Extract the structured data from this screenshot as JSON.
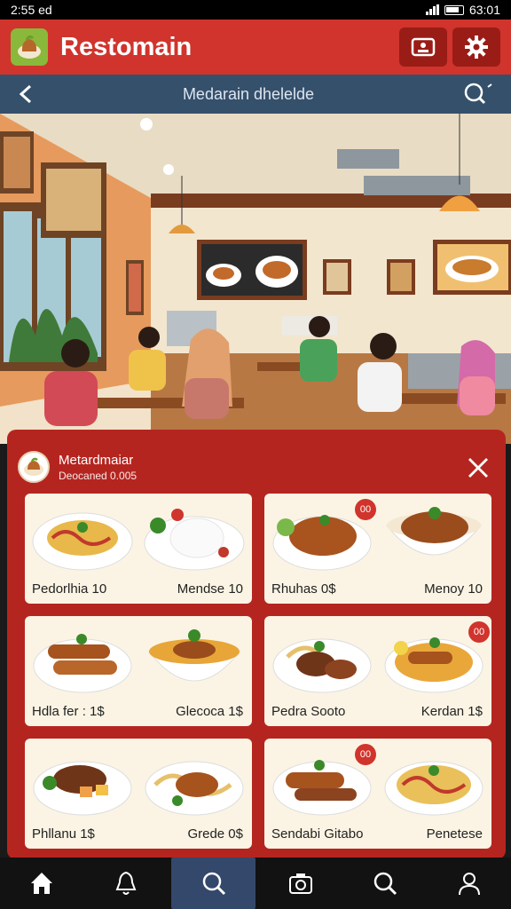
{
  "status_bar": {
    "time": "2:55 ed",
    "clock": "63:01"
  },
  "app_bar": {
    "title": "Restomain",
    "logo_icon": "chicken-dish-icon",
    "buttons": [
      "profile-card-icon",
      "gear-icon"
    ]
  },
  "nav_bar": {
    "title": "Medarain dhelelde",
    "back_icon": "chevron-left-icon",
    "search_icon": "search-icon"
  },
  "panel": {
    "name": "Metardmaiar",
    "sub": "Deocaned 0.005",
    "close_icon": "close-icon",
    "cards": [
      {
        "left_label": "Pedorlhia 10",
        "right_label": "Mendse 10",
        "badge": ""
      },
      {
        "left_label": "Rhuhas 0$",
        "right_label": "Menoy 10",
        "badge": "00"
      },
      {
        "left_label": "Hdla fer : 1$",
        "right_label": "Glecoca 1$",
        "badge": ""
      },
      {
        "left_label": "Pedra Sooto",
        "right_label": "Kerdan 1$",
        "badge": "00"
      },
      {
        "left_label": "Phllanu 1$",
        "right_label": "Grede 0$",
        "badge": ""
      },
      {
        "left_label": "Sendabi Gitabo",
        "right_label": "Penetese",
        "badge": "00"
      }
    ]
  },
  "bottom_nav": [
    "home-icon",
    "bell-icon",
    "search-icon",
    "camera-icon",
    "search-icon",
    "profile-icon"
  ],
  "colors": {
    "brand_red": "#d0342c",
    "panel_red": "#b52520",
    "nav_blue": "#35506b",
    "active_nav": "#33486a"
  }
}
